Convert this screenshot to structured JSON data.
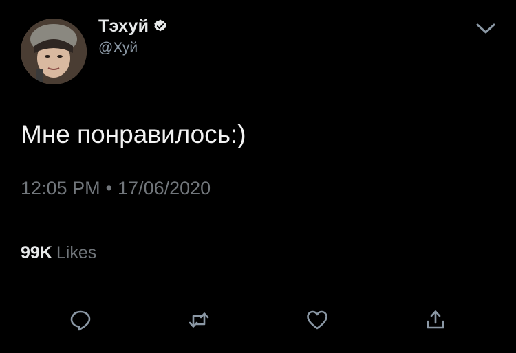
{
  "author": {
    "display_name": "Тэхуй",
    "handle": "@Хуй",
    "verified": true,
    "avatar": "profile-photo"
  },
  "tweet": {
    "text": "Мне понравилось:)",
    "time": "12:05 PM",
    "separator": "•",
    "date": "17/06/2020"
  },
  "stats": {
    "likes_count": "99K",
    "likes_label": "Likes"
  },
  "actions": {
    "reply_icon": "reply-icon",
    "retweet_icon": "retweet-icon",
    "like_icon": "heart-icon",
    "share_icon": "share-icon",
    "menu_icon": "chevron-down-icon"
  },
  "colors": {
    "background": "#000000",
    "text_primary": "#e7e9ea",
    "text_secondary": "#71767b",
    "divider": "#2f3336"
  }
}
